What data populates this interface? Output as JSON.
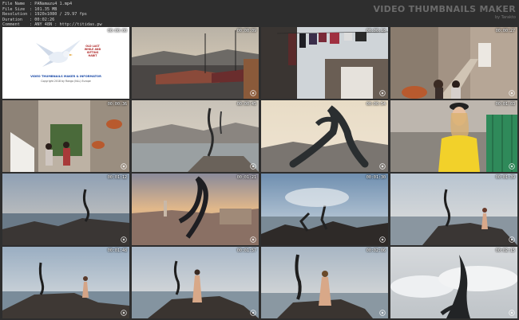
{
  "meta": [
    {
      "k": "File Name",
      "v": ": PANamazu4 1.mp4"
    },
    {
      "k": "File Size",
      "v": ": 101.35 MB"
    },
    {
      "k": "Resolution",
      "v": ": 1920x1080 / 29.97 fps"
    },
    {
      "k": "Duration",
      "v": ": 00:02:26"
    },
    {
      "k": "Comment",
      "v": ": ANY 48N : http://titidas.pw"
    }
  ],
  "brand": {
    "title": "VIDEO THUMBNAILS MAKER",
    "sub": "by Tarakto"
  },
  "logo": {
    "badge_lines": [
      "OLD LAST",
      "WHILE AND",
      "GIFTING",
      "HABIT"
    ],
    "title": "VIDEO THUMBNAILS MAKER & INFORMATOR",
    "copy": "Copyright 2018 by Rango (NLL) Europe"
  },
  "timestamps": [
    "00:00:00",
    "00:00:09",
    "00:00:18",
    "00:00:27",
    "00:00:36",
    "00:00:45",
    "00:00:54",
    "00:01:03",
    "00:01:12",
    "00:01:21",
    "00:01:30",
    "00:01:39",
    "00:01:48",
    "00:01:57",
    "00:02:06",
    "00:02:15"
  ]
}
